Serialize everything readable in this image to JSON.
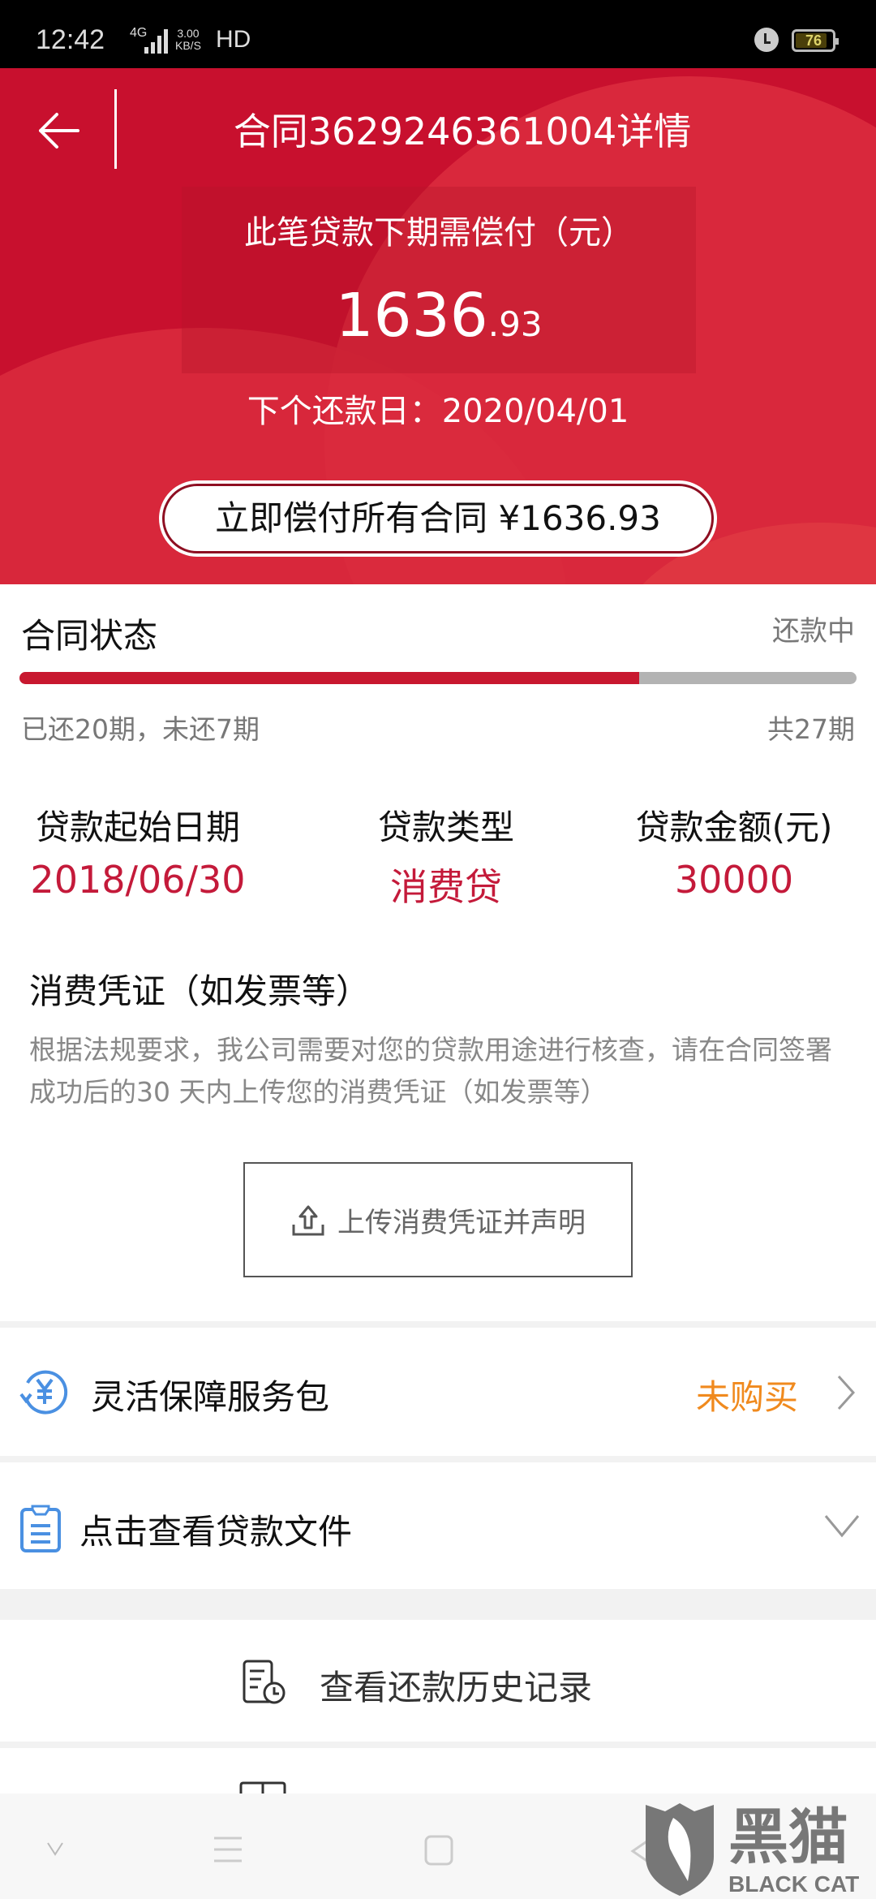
{
  "status_bar": {
    "time": "12:42",
    "network": "4G",
    "speed_value": "3.00",
    "speed_unit": "KB/S",
    "hd": "HD",
    "battery": "76"
  },
  "header": {
    "back_icon": "arrow-left-icon",
    "title": "合同3629246361004详情"
  },
  "due": {
    "label": "此笔贷款下期需偿付（元）",
    "amount_int": "1636",
    "amount_dec": ".93",
    "next_date_label": "下个还款日：2020/04/01",
    "pay_all_button": "立即偿付所有合同 ¥1636.93"
  },
  "contract_status": {
    "title": "合同状态",
    "status": "还款中",
    "paid_periods": 20,
    "total_periods": 27,
    "progress_fraction": 0.7407,
    "paid_text": "已还20期，未还7期",
    "total_text": "共27期"
  },
  "loan_info": [
    {
      "label": "贷款起始日期",
      "value": "2018/06/30"
    },
    {
      "label": "贷款类型",
      "value": "消费贷"
    },
    {
      "label": "贷款金额(元)",
      "value": "30000"
    }
  ],
  "voucher": {
    "title": "消费凭证（如发票等）",
    "description": "根据法规要求，我公司需要对您的贷款用途进行核查，请在合同签署成功后的30 天内上传您的消费凭证（如发票等）",
    "upload_button": "上传消费凭证并声明",
    "upload_icon": "upload-icon"
  },
  "rows": {
    "service_pack": {
      "label": "灵活保障服务包",
      "state": "未购买",
      "icon": "yuan-refresh-icon",
      "chevron": "chevron-right-icon"
    },
    "loan_docs": {
      "label": "点击查看贷款文件",
      "icon": "clipboard-icon",
      "chevron": "chevron-down-icon"
    },
    "history": {
      "label": "查看还款历史记录",
      "icon": "history-doc-icon"
    }
  },
  "colors": {
    "brand_red": "#c8102e",
    "value_red": "#c41a3a",
    "accent_orange": "#f08a1e",
    "icon_blue": "#4a90e2"
  },
  "watermark": {
    "cn": "黑猫",
    "en": "BLACK CAT"
  }
}
